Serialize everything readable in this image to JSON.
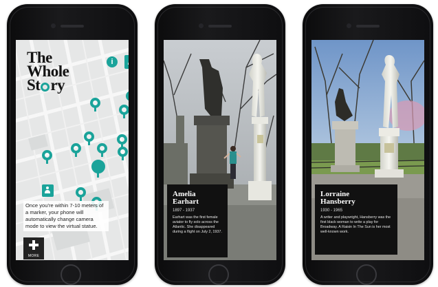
{
  "screen1": {
    "logo_line1": "The",
    "logo_line2": "Whole",
    "logo_line3_part1": "St",
    "logo_line3_part2": "ry",
    "info_icon_glyph": "i",
    "hint_text": "Once you're within 7-10 meters of a marker, your phone will automatically change camera mode to view the virtual statue.",
    "more_label": "MORE",
    "accent_color": "#1aa39a"
  },
  "screen2": {
    "name_line1": "Amelia",
    "name_line2": "Earhart",
    "years": "1897 - 1937",
    "bio": "Earhart was the first female aviator to fly solo across the Atlantic. She disappeared during a flight on July 2, 1937."
  },
  "screen3": {
    "name_line1": "Lorraine",
    "name_line2": "Hansberry",
    "years": "1930 - 1965",
    "bio": "A writer and playwright, Hansberry was the first black woman to write a play for Broadway. A Raisin In The Sun is her most well-known work."
  }
}
